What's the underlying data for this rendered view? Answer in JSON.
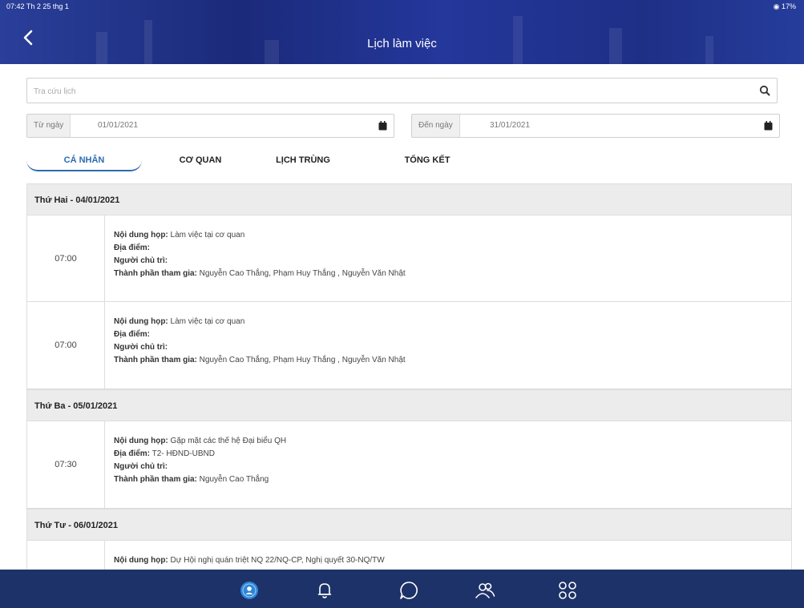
{
  "status_bar": {
    "time": "07:42  Th 2 25 thg 1",
    "battery": "17%"
  },
  "header": {
    "title": "Lịch làm việc"
  },
  "search": {
    "placeholder": "Tra cứu lịch"
  },
  "date_range": {
    "from_label": "Từ ngày",
    "from_value": "01/01/2021",
    "to_label": "Đến ngày",
    "to_value": "31/01/2021"
  },
  "tabs": [
    {
      "label": "CÁ NHÂN",
      "active": true
    },
    {
      "label": "CƠ QUAN",
      "active": false
    },
    {
      "label": "LỊCH TRÙNG",
      "active": false
    },
    {
      "label": "TỔNG KẾT",
      "active": false
    }
  ],
  "field_labels": {
    "content": "Nội dung họp:",
    "location": "Địa điểm:",
    "chair": "Người chủ trì:",
    "participants": "Thành phần tham gia:"
  },
  "days": [
    {
      "title": "Thứ Hai - 04/01/2021",
      "events": [
        {
          "time": "07:00",
          "content": "Làm việc tại cơ quan",
          "location": "",
          "chair": "",
          "participants": "Nguyễn Cao Thắng, Phạm Huy Thắng , Nguyễn Văn Nhật"
        },
        {
          "time": "07:00",
          "content": "Làm việc tại cơ quan",
          "location": "",
          "chair": "",
          "participants": "Nguyễn Cao Thắng, Phạm Huy Thắng , Nguyễn Văn Nhật"
        }
      ]
    },
    {
      "title": "Thứ Ba - 05/01/2021",
      "events": [
        {
          "time": "07:30",
          "content": "Gặp mặt các thế hệ Đại biểu QH",
          "location": "T2- HĐND-UBND",
          "chair": "",
          "participants": "Nguyễn Cao Thắng"
        }
      ]
    },
    {
      "title": "Thứ Tư - 06/01/2021",
      "events": [
        {
          "time": "",
          "content": "Dự Hội nghị quán triệt NQ 22/NQ-CP, Nghị quyết 30-NQ/TW",
          "location": "",
          "chair": "",
          "participants": ""
        }
      ]
    }
  ],
  "bottom_nav": [
    {
      "icon": "user-circle-icon",
      "active": true
    },
    {
      "icon": "bell-icon",
      "active": false
    },
    {
      "icon": "chat-icon",
      "active": false
    },
    {
      "icon": "users-icon",
      "active": false
    },
    {
      "icon": "apps-grid-icon",
      "active": false
    }
  ],
  "colors": {
    "header": "#1f3488",
    "accent": "#2b6cb0",
    "bottom_nav": "#1d3268",
    "day_header_bg": "#ececec"
  }
}
